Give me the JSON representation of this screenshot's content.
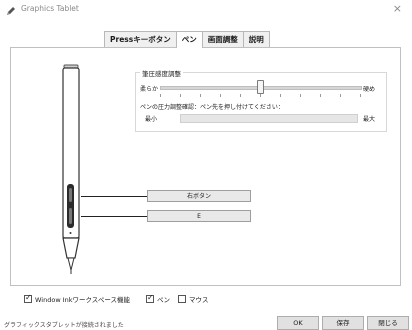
{
  "window": {
    "title": "Graphics Tablet",
    "app_icon": "pen-icon",
    "close_glyph": "×"
  },
  "tabs": [
    {
      "label": "Pressキーボタン",
      "active": false
    },
    {
      "label": "ペン",
      "active": true
    },
    {
      "label": "画面調整",
      "active": false
    },
    {
      "label": "説明",
      "active": false
    }
  ],
  "pressure": {
    "group_title": "筆圧感度調整",
    "soft_label": "柔らか",
    "hard_label": "硬め",
    "slider_value": 0.5,
    "test_instruction": "ペンの圧力調整確認：ペン先を押し付けてください：",
    "min_label": "最小",
    "max_label": "最大",
    "pressure_level": 0
  },
  "pen_buttons": {
    "upper": "右ボタン",
    "lower": "E"
  },
  "options": {
    "windows_ink": {
      "label": "Window Inkワークスペース機能",
      "checked": true
    },
    "pen": {
      "label": "ペン",
      "checked": true
    },
    "mouse": {
      "label": "マウス",
      "checked": false
    }
  },
  "status_text": "グラフィックスタブレットが接続されました",
  "footer": {
    "ok": "OK",
    "save": "保存",
    "close": "閉じる"
  }
}
